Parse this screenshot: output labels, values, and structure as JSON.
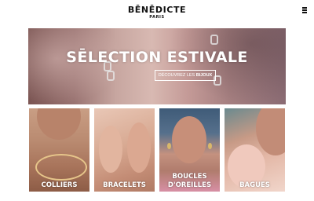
{
  "header": {
    "brand": "BĒNĒDICTE",
    "brand_sub": "PARIS",
    "menu_icon": "hamburger-menu-icon"
  },
  "hero": {
    "title": "SĒLECTION ESTIVALE",
    "cta_prefix": "DÉCOUVREZ LES ",
    "cta_bold": "BIJOUX"
  },
  "categories": [
    {
      "label": "COLLIERS"
    },
    {
      "label": "BRACELETS"
    },
    {
      "label": "BOUCLES D'OREILLES"
    },
    {
      "label": "BAGUES"
    }
  ]
}
